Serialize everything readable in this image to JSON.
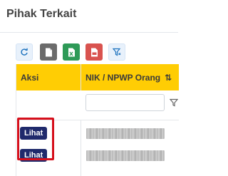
{
  "page": {
    "title": "Pihak Terkait"
  },
  "toolbar": {
    "buttons": [
      {
        "icon": "refresh-icon",
        "color": "#1e73be"
      },
      {
        "icon": "file-icon",
        "color": "#5a5a5a"
      },
      {
        "icon": "excel-icon",
        "color": "#2e9a57"
      },
      {
        "icon": "pdf-icon",
        "color": "#c9302c"
      },
      {
        "icon": "filter-clear-icon",
        "color": "#1e73be"
      }
    ]
  },
  "table": {
    "header_color": "#ffcd04",
    "columns": [
      {
        "label": "Aksi"
      },
      {
        "label": "NIK / NPWP Orang",
        "sort_icon": "⇅"
      }
    ],
    "filter": {
      "value": "",
      "placeholder": ""
    },
    "rows": [
      {
        "action_label": "Lihat"
      },
      {
        "action_label": "Lihat"
      }
    ]
  },
  "accent": {
    "button": "#1f2a6c",
    "highlight": "#d6101c"
  }
}
